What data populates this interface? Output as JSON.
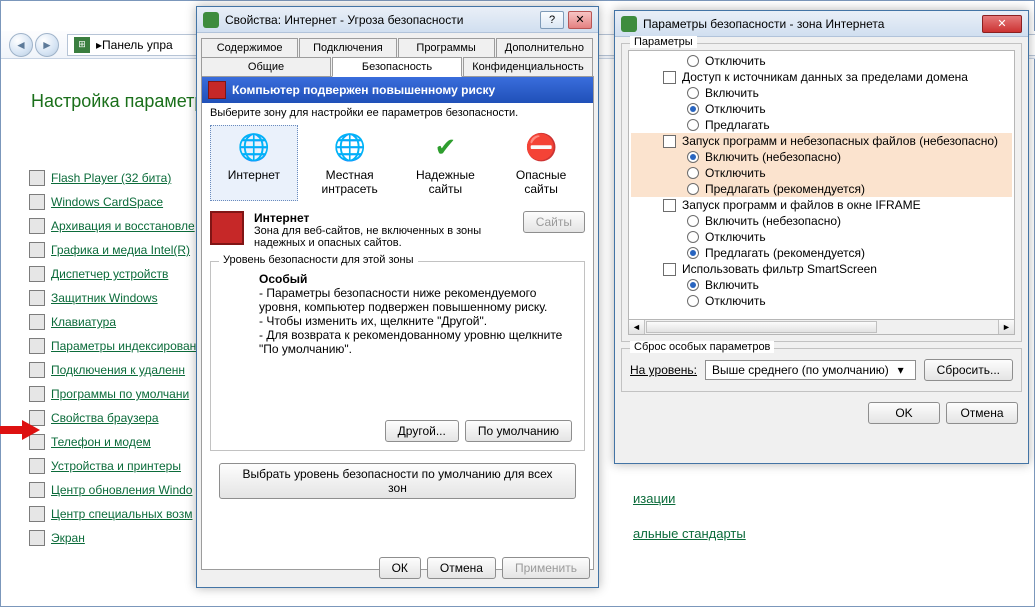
{
  "cpanel": {
    "breadcrumb_icon": "control-panel",
    "breadcrumb_text": "Панель упра",
    "title": "Настройка параметро",
    "items": [
      "Flash Player (32 бита)",
      "Windows CardSpace",
      "Архивация и восстановле",
      "Графика и медиа Intel(R)",
      "Диспетчер устройств",
      "Защитник Windows",
      "Клавиатура",
      "Параметры индексирован",
      "Подключения к удаленн",
      "Программы по умолчани",
      "Свойства браузера",
      "Телефон и модем",
      "Устройства и принтеры",
      "Центр обновления Windo",
      "Центр специальных возм",
      "Экран"
    ],
    "fragments": [
      "изации",
      "альные стандарты"
    ]
  },
  "props": {
    "title": "Свойства: Интернет - Угроза безопасности",
    "help": "?",
    "close": "✕",
    "tabs_row1": [
      "Содержимое",
      "Подключения",
      "Программы",
      "Дополнительно"
    ],
    "tabs_row2": [
      "Общие",
      "Безопасность",
      "Конфиденциальность"
    ],
    "selected_tab": "Безопасность",
    "warn": "Компьютер подвержен повышенному риску",
    "zone_instr": "Выберите зону для настройки ее параметров безопасности.",
    "zones": [
      {
        "label": "Интернет",
        "icon": "globe"
      },
      {
        "label": "Местная интрасеть",
        "icon": "globe-monitor"
      },
      {
        "label": "Надежные сайты",
        "icon": "check"
      },
      {
        "label": "Опасные сайты",
        "icon": "forbid"
      }
    ],
    "desc_title": "Интернет",
    "desc_body": "Зона для веб-сайтов, не включенных в зоны надежных и опасных сайтов.",
    "sites_btn": "Сайты",
    "level_group": "Уровень безопасности для этой зоны",
    "level_name": "Особый",
    "level_lines": [
      "- Параметры безопасности ниже рекомендуемого уровня, компьютер подвержен повышенному риску.",
      "- Чтобы изменить их, щелкните \"Другой\".",
      "- Для возврата к рекомендованному уровню щелкните \"По умолчанию\"."
    ],
    "btn_custom": "Другой...",
    "btn_default": "По умолчанию",
    "btn_allzones": "Выбрать уровень безопасности по умолчанию для всех зон",
    "ok": "ОК",
    "cancel": "Отмена",
    "apply": "Применить"
  },
  "sec": {
    "title": "Параметры безопасности - зона Интернета",
    "close": "✕",
    "group1": "Параметры",
    "tree": [
      {
        "t": "opt",
        "label": "Отключить",
        "sel": false
      },
      {
        "t": "setting",
        "label": "Доступ к источникам данных за пределами домена",
        "cb": true
      },
      {
        "t": "opt",
        "label": "Включить",
        "sel": false
      },
      {
        "t": "opt",
        "label": "Отключить",
        "sel": true
      },
      {
        "t": "opt",
        "label": "Предлагать",
        "sel": false
      },
      {
        "t": "setting",
        "label": "Запуск программ и небезопасных файлов (небезопасно)",
        "cb": true,
        "hl": true
      },
      {
        "t": "opt",
        "label": "Включить (небезопасно)",
        "sel": true,
        "hl": true
      },
      {
        "t": "opt",
        "label": "Отключить",
        "sel": false,
        "hl": true
      },
      {
        "t": "opt",
        "label": "Предлагать (рекомендуется)",
        "sel": false,
        "hl": true
      },
      {
        "t": "setting",
        "label": "Запуск программ и файлов в окне IFRAME",
        "cb": true
      },
      {
        "t": "opt",
        "label": "Включить (небезопасно)",
        "sel": false
      },
      {
        "t": "opt",
        "label": "Отключить",
        "sel": false
      },
      {
        "t": "opt",
        "label": "Предлагать (рекомендуется)",
        "sel": true
      },
      {
        "t": "setting",
        "label": "Использовать фильтр SmartScreen",
        "cb": true
      },
      {
        "t": "opt",
        "label": "Включить",
        "sel": true
      },
      {
        "t": "opt",
        "label": "Отключить",
        "sel": false
      }
    ],
    "group2": "Сброс особых параметров",
    "reset_lbl": "На уровень:",
    "combo": "Выше среднего (по умолчанию)",
    "btn_reset": "Сбросить...",
    "ok": "OK",
    "cancel": "Отмена"
  }
}
